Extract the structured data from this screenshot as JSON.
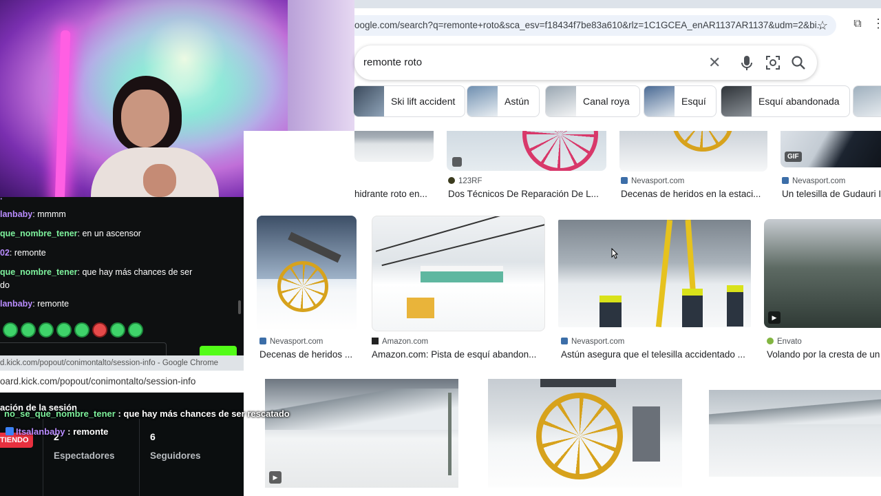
{
  "browser": {
    "url": "oogle.com/search?q=remonte+roto&sca_esv=f18434f7be83a610&rlz=1C1GCEA_enAR1137AR1137&udm=2&bi...",
    "search_query": "remonte roto",
    "chips": [
      {
        "label": "Ski lift accident"
      },
      {
        "label": "Astún"
      },
      {
        "label": "Canal roya"
      },
      {
        "label": "Esquí"
      },
      {
        "label": "Esquí abandonada"
      }
    ]
  },
  "results": {
    "row1": [
      {
        "source": "",
        "title": "hidrante roto en..."
      },
      {
        "source": "123RF",
        "title": "Dos Técnicos De Reparación De L..."
      },
      {
        "source": "Nevasport.com",
        "title": "Decenas de heridos en la estaci..."
      },
      {
        "source": "Nevasport.com",
        "title": "Un telesilla de Gudauri I",
        "badge": "GIF"
      }
    ],
    "row2": [
      {
        "source": "Nevasport.com",
        "title": "Decenas de heridos ..."
      },
      {
        "source": "Amazon.com",
        "title": "Amazon.com: Pista de esquí abandon..."
      },
      {
        "source": "Nevasport.com",
        "title": "Astún asegura que el telesilla accidentado ..."
      },
      {
        "source": "Envato",
        "title": "Volando por la cresta de un"
      }
    ]
  },
  "chat": {
    "messages": [
      {
        "user": "lanbaby",
        "text": ": mmmm"
      },
      {
        "user": "que_nombre_tener",
        "text": ": en un ascensor"
      },
      {
        "user": "02",
        "text": ": remonte"
      },
      {
        "user": "que_nombre_tener",
        "text": ": que hay más chances de ser"
      },
      {
        "user": "",
        "text": "do"
      },
      {
        "user": "lanbaby",
        "text": ": remonte"
      }
    ]
  },
  "popout": {
    "window_title": "d.kick.com/popout/conimontalto/session-info - Google Chrome",
    "url": "oard.kick.com/popout/conimontalto/session-info",
    "session_title": "ación de la sesión",
    "live_badge": "TIENDO",
    "viewers_count": "2",
    "viewers_label": "Espectadores",
    "followers_count": "6",
    "followers_label": "Seguidores"
  },
  "overlay": {
    "line1_user": "no_se_que_nombre_tener",
    "line1_text": " : que hay más chances de ser rescatado",
    "line2_user": "Itsalanbaby",
    "line2_text": " : remonte"
  },
  "colors": {
    "kick_green": "#53fc18",
    "live_red": "#e8303f",
    "chat_purple": "#b98cff",
    "chat_green": "#7ef29d"
  }
}
